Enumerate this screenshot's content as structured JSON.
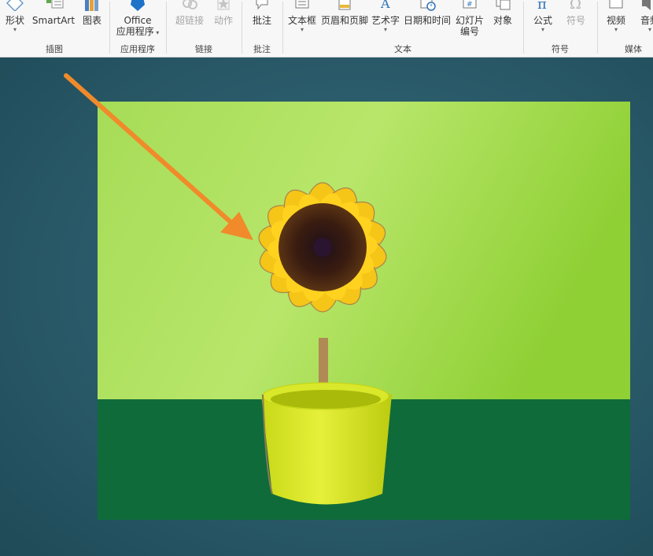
{
  "ribbon": {
    "groups": [
      {
        "label": "插图",
        "buttons": [
          {
            "label": "形状",
            "icon": "shapes-icon",
            "dropdown": true,
            "enabled": true
          },
          {
            "label": "SmartArt",
            "icon": "smartart-icon",
            "dropdown": false,
            "enabled": true
          },
          {
            "label": "图表",
            "icon": "chart-icon",
            "dropdown": false,
            "enabled": true
          }
        ]
      },
      {
        "label": "应用程序",
        "buttons": [
          {
            "label": "Office",
            "label2": "应用程序",
            "icon": "office-apps-icon",
            "dropdown": true,
            "enabled": true
          }
        ]
      },
      {
        "label": "链接",
        "buttons": [
          {
            "label": "超链接",
            "icon": "hyperlink-icon",
            "dropdown": false,
            "enabled": false
          },
          {
            "label": "动作",
            "icon": "action-icon",
            "dropdown": false,
            "enabled": false
          }
        ]
      },
      {
        "label": "批注",
        "buttons": [
          {
            "label": "批注",
            "icon": "comment-icon",
            "dropdown": false,
            "enabled": true
          }
        ]
      },
      {
        "label": "文本",
        "buttons": [
          {
            "label": "文本框",
            "icon": "textbox-icon",
            "dropdown": true,
            "enabled": true
          },
          {
            "label": "页眉和页脚",
            "icon": "header-footer-icon",
            "dropdown": false,
            "enabled": true
          },
          {
            "label": "艺术字",
            "icon": "wordart-icon",
            "dropdown": true,
            "enabled": true
          },
          {
            "label": "日期和时间",
            "icon": "date-time-icon",
            "dropdown": false,
            "enabled": true
          },
          {
            "label": "幻灯片",
            "label2": "编号",
            "icon": "slide-number-icon",
            "dropdown": false,
            "enabled": true
          },
          {
            "label": "对象",
            "icon": "object-icon",
            "dropdown": false,
            "enabled": true
          }
        ]
      },
      {
        "label": "符号",
        "buttons": [
          {
            "label": "公式",
            "icon": "equation-icon",
            "dropdown": true,
            "enabled": true
          },
          {
            "label": "符号",
            "icon": "symbol-icon",
            "dropdown": false,
            "enabled": false
          }
        ]
      },
      {
        "label": "媒体",
        "buttons": [
          {
            "label": "视频",
            "icon": "video-icon",
            "dropdown": true,
            "enabled": true
          },
          {
            "label": "音频",
            "icon": "audio-icon",
            "dropdown": true,
            "enabled": true
          }
        ]
      }
    ]
  },
  "colors": {
    "ribbon_bg": "#f7f7f7",
    "accent_blue": "#2e73b8",
    "slide_bg": "#2c5d6c",
    "photo_wall": "#9fd64a",
    "photo_table": "#0f6b3a",
    "pot": "#d6e61c",
    "petal": "#f5c518",
    "flower_center": "#3a1e10",
    "annotation_arrow": "#f08a2a",
    "selection_outline": "#9a7a55"
  }
}
